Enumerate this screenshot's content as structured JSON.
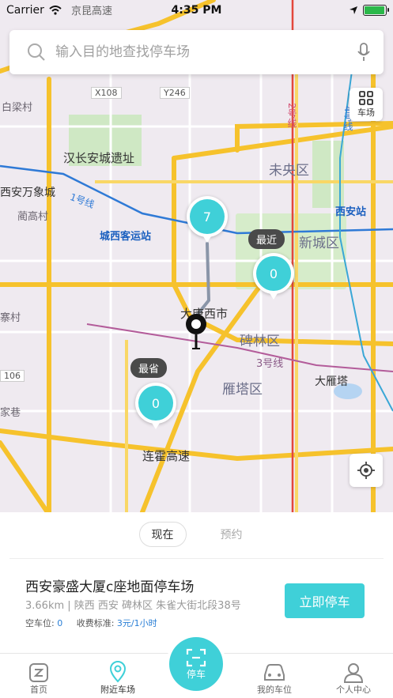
{
  "status": {
    "carrier": "Carrier",
    "time": "4:35 PM",
    "battery_level": 0.95
  },
  "search": {
    "placeholder": "输入目的地查找停车场"
  },
  "map": {
    "layer_button": "车场",
    "labels": {
      "xian_lake": "西安万象城",
      "han_site": "汉长安城遗址",
      "weiyang": "未央区",
      "xincheng": "新城区",
      "beilin": "碑林区",
      "yanta": "雁塔区",
      "dayanta": "大雁塔",
      "datangxishi": "大唐西市",
      "chengxi_station": "城西客运站",
      "xian_station": "西安站",
      "lianhuo": "连霍高速",
      "nangao": "蔺高村",
      "baili": "白梁村",
      "zhaicun": "寨村",
      "jiaxiang": "家巷",
      "road_x108": "X108",
      "road_y246": "Y246",
      "road_106": "106",
      "top_road": "京昆高速",
      "metro1": "1号线",
      "metro2": "2号线",
      "metro3": "3号线",
      "metro4": "4号线"
    },
    "clusters": [
      {
        "count": "7"
      },
      {
        "count": "0"
      },
      {
        "count": "0"
      }
    ],
    "tags": {
      "nearest": "最近",
      "cheapest": "最省"
    }
  },
  "panel": {
    "tab_now": "现在",
    "tab_reserve": "预约",
    "lot_name": "西安豪盛大厦c座地面停车场",
    "lot_address": "3.66km | 陕西 西安 碑林区 朱雀大街北段38号",
    "free_label": "空车位:",
    "free_value": "0",
    "fee_label": "收费标准:",
    "fee_value": "3元/1小时",
    "park_button": "立即停车"
  },
  "tabbar": {
    "home": "首页",
    "nearby": "附近车场",
    "park": "停车",
    "my_spot": "我的车位",
    "profile": "个人中心"
  },
  "colors": {
    "accent": "#3fd0d8",
    "road_major": "#f6c22c",
    "metro1": "#2f7ad6",
    "metro2": "#e3473c",
    "metro3": "#b35c9a"
  }
}
